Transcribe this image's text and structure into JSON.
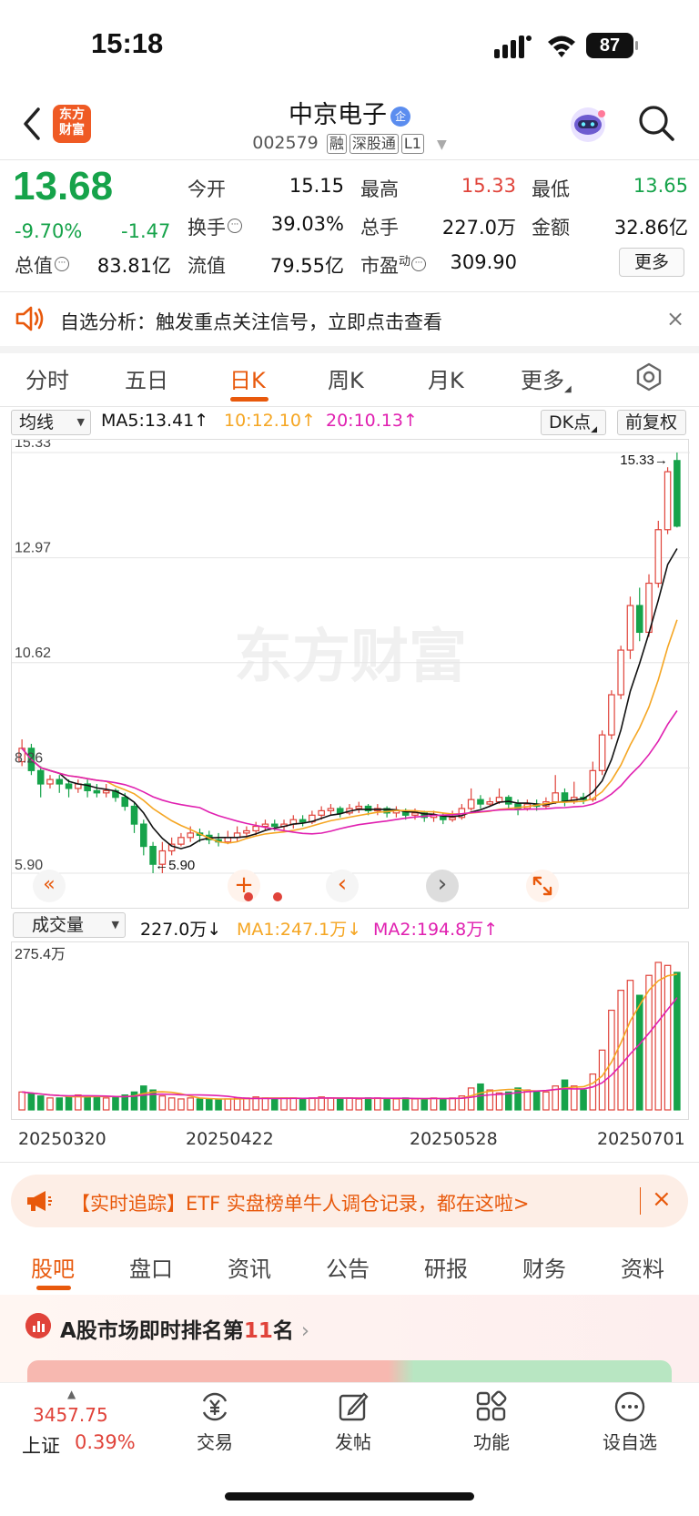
{
  "status_bar": {
    "time": "15:18",
    "battery": "87"
  },
  "header": {
    "logo_text_1": "东方",
    "logo_text_2": "财富",
    "stock_name": "中京电子",
    "name_badge": "企",
    "code": "002579",
    "tags": [
      "融",
      "深股通",
      "L1"
    ]
  },
  "quote": {
    "price": "13.68",
    "change_pct": "-9.70%",
    "change_val": "-1.47",
    "fields": {
      "open_label": "今开",
      "open": "15.15",
      "high_label": "最高",
      "high": "15.33",
      "low_label": "最低",
      "low": "13.65",
      "turnover_label": "换手",
      "turnover": "39.03%",
      "total_hands_label": "总手",
      "total_hands": "227.0万",
      "amount_label": "金额",
      "amount": "32.86亿",
      "mkt_cap_label": "总值",
      "mkt_cap": "83.81亿",
      "float_cap_label": "流值",
      "float_cap": "79.55亿",
      "pe_label": "市盈",
      "pe_sup": "动",
      "pe": "309.90"
    },
    "more_button": "更多"
  },
  "notice": {
    "text": "自选分析：触发重点关注信号，立即点击查看",
    "close": "×"
  },
  "period_tabs": [
    {
      "label": "分时"
    },
    {
      "label": "五日"
    },
    {
      "label": "日K"
    },
    {
      "label": "周K"
    },
    {
      "label": "月K"
    },
    {
      "label": "更多"
    }
  ],
  "chart_header": {
    "indicator_select": "均线",
    "ma5": "MA5:13.41",
    "ma10": "10:12.10",
    "ma20": "20:10.13",
    "dk_button": "DK点",
    "adjust_button": "前复权"
  },
  "chart_data": {
    "type": "candlestick",
    "y_ticks": [
      "15.33",
      "12.97",
      "10.62",
      "8.26",
      "5.90"
    ],
    "ylim": [
      5.9,
      15.33
    ],
    "max_label": "15.33",
    "min_label": "5.90",
    "watermark": "东方财富",
    "colors": {
      "up": "#e0433a",
      "down": "#16a34a",
      "ma5": "#111111",
      "ma10": "#f5a623",
      "ma20": "#e020b0"
    },
    "candles": [
      [
        8.4,
        8.7,
        8.9,
        8.3
      ],
      [
        8.7,
        8.2,
        8.8,
        8.1
      ],
      [
        8.2,
        7.9,
        8.3,
        7.6
      ],
      [
        7.9,
        8.0,
        8.1,
        7.8
      ],
      [
        8.0,
        7.9,
        8.1,
        7.7
      ],
      [
        7.9,
        7.8,
        8.0,
        7.6
      ],
      [
        7.8,
        7.9,
        8.0,
        7.7
      ],
      [
        7.9,
        7.75,
        8.0,
        7.6
      ],
      [
        7.75,
        7.7,
        7.9,
        7.6
      ],
      [
        7.7,
        7.75,
        7.9,
        7.6
      ],
      [
        7.75,
        7.6,
        7.8,
        7.5
      ],
      [
        7.6,
        7.4,
        7.7,
        7.3
      ],
      [
        7.4,
        7.0,
        7.5,
        6.8
      ],
      [
        7.0,
        6.5,
        7.1,
        6.3
      ],
      [
        6.5,
        6.1,
        6.6,
        5.9
      ],
      [
        6.1,
        6.4,
        6.6,
        5.9
      ],
      [
        6.4,
        6.55,
        6.7,
        6.3
      ],
      [
        6.55,
        6.7,
        6.8,
        6.5
      ],
      [
        6.7,
        6.8,
        6.95,
        6.6
      ],
      [
        6.8,
        6.75,
        6.9,
        6.6
      ],
      [
        6.75,
        6.65,
        6.85,
        6.55
      ],
      [
        6.65,
        6.6,
        6.8,
        6.5
      ],
      [
        6.6,
        6.7,
        6.85,
        6.55
      ],
      [
        6.7,
        6.8,
        6.95,
        6.6
      ],
      [
        6.8,
        6.85,
        6.95,
        6.7
      ],
      [
        6.85,
        6.95,
        7.05,
        6.75
      ],
      [
        6.95,
        7.0,
        7.1,
        6.85
      ],
      [
        7.0,
        6.95,
        7.1,
        6.85
      ],
      [
        6.95,
        7.0,
        7.1,
        6.85
      ],
      [
        7.0,
        7.1,
        7.2,
        6.9
      ],
      [
        7.1,
        7.05,
        7.2,
        6.95
      ],
      [
        7.05,
        7.2,
        7.3,
        7.0
      ],
      [
        7.2,
        7.3,
        7.4,
        7.1
      ],
      [
        7.3,
        7.35,
        7.45,
        7.2
      ],
      [
        7.35,
        7.25,
        7.4,
        7.15
      ],
      [
        7.25,
        7.35,
        7.45,
        7.2
      ],
      [
        7.35,
        7.4,
        7.5,
        7.25
      ],
      [
        7.4,
        7.3,
        7.45,
        7.2
      ],
      [
        7.3,
        7.35,
        7.45,
        7.2
      ],
      [
        7.35,
        7.25,
        7.4,
        7.15
      ],
      [
        7.25,
        7.3,
        7.4,
        7.15
      ],
      [
        7.3,
        7.2,
        7.35,
        7.1
      ],
      [
        7.2,
        7.25,
        7.35,
        7.1
      ],
      [
        7.25,
        7.15,
        7.3,
        7.05
      ],
      [
        7.15,
        7.2,
        7.3,
        7.05
      ],
      [
        7.2,
        7.1,
        7.25,
        7.0
      ],
      [
        7.1,
        7.15,
        7.3,
        7.05
      ],
      [
        7.15,
        7.35,
        7.45,
        7.1
      ],
      [
        7.35,
        7.55,
        7.8,
        7.3
      ],
      [
        7.55,
        7.45,
        7.65,
        7.35
      ],
      [
        7.45,
        7.5,
        7.6,
        7.4
      ],
      [
        7.5,
        7.6,
        7.8,
        7.45
      ],
      [
        7.6,
        7.45,
        7.65,
        7.35
      ],
      [
        7.45,
        7.35,
        7.55,
        7.2
      ],
      [
        7.35,
        7.45,
        7.55,
        7.3
      ],
      [
        7.45,
        7.4,
        7.55,
        7.3
      ],
      [
        7.4,
        7.5,
        7.6,
        7.35
      ],
      [
        7.5,
        7.7,
        8.1,
        7.45
      ],
      [
        7.7,
        7.5,
        7.8,
        7.4
      ],
      [
        7.5,
        7.6,
        7.95,
        7.45
      ],
      [
        7.6,
        7.55,
        7.7,
        7.45
      ],
      [
        7.55,
        8.2,
        8.4,
        7.5
      ],
      [
        8.2,
        9.0,
        9.1,
        8.1
      ],
      [
        9.0,
        9.9,
        10.0,
        8.9
      ],
      [
        9.9,
        10.9,
        11.0,
        9.8
      ],
      [
        10.9,
        11.9,
        12.1,
        10.7
      ],
      [
        11.9,
        11.3,
        12.3,
        11.1
      ],
      [
        11.3,
        12.4,
        12.6,
        11.2
      ],
      [
        12.4,
        13.6,
        13.8,
        12.3
      ],
      [
        13.6,
        14.9,
        15.0,
        13.5
      ],
      [
        15.15,
        13.68,
        15.33,
        13.65
      ]
    ]
  },
  "nav_controls": [
    "«",
    "+",
    "‹",
    "›"
  ],
  "volume": {
    "select": "成交量",
    "value": "227.0万",
    "ma1": "MA1:247.1万",
    "ma2": "MA2:194.8万",
    "max_label": "275.4万",
    "dates": [
      "20250320",
      "20250422",
      "20250528",
      "20250701"
    ],
    "bars": [
      18,
      16,
      14,
      12,
      12,
      13,
      15,
      14,
      13,
      12,
      13,
      15,
      18,
      24,
      20,
      14,
      12,
      11,
      12,
      11,
      11,
      10,
      11,
      12,
      12,
      13,
      12,
      11,
      12,
      12,
      11,
      12,
      13,
      12,
      11,
      12,
      11,
      12,
      12,
      11,
      11,
      12,
      11,
      11,
      12,
      11,
      12,
      14,
      22,
      26,
      20,
      17,
      18,
      22,
      20,
      18,
      18,
      24,
      30,
      24,
      20,
      36,
      60,
      100,
      120,
      130,
      115,
      135,
      148,
      145,
      138
    ]
  },
  "ad": {
    "text": "【实时追踪】ETF 实盘榜单牛人调仓记录，都在这啦>",
    "close": "×"
  },
  "bottom_tabs": [
    {
      "label": "股吧"
    },
    {
      "label": "盘口"
    },
    {
      "label": "资讯"
    },
    {
      "label": "公告"
    },
    {
      "label": "研报"
    },
    {
      "label": "财务"
    },
    {
      "label": "资料"
    }
  ],
  "rank": {
    "prefix": "A股市场即时排名第",
    "num": "11",
    "suffix": "名"
  },
  "bottom_nav": {
    "index_value": "3457.75",
    "index_name": "上证",
    "index_pct": "0.39%",
    "items": [
      {
        "label": "交易"
      },
      {
        "label": "发帖"
      },
      {
        "label": "功能"
      },
      {
        "label": "设自选"
      }
    ]
  }
}
